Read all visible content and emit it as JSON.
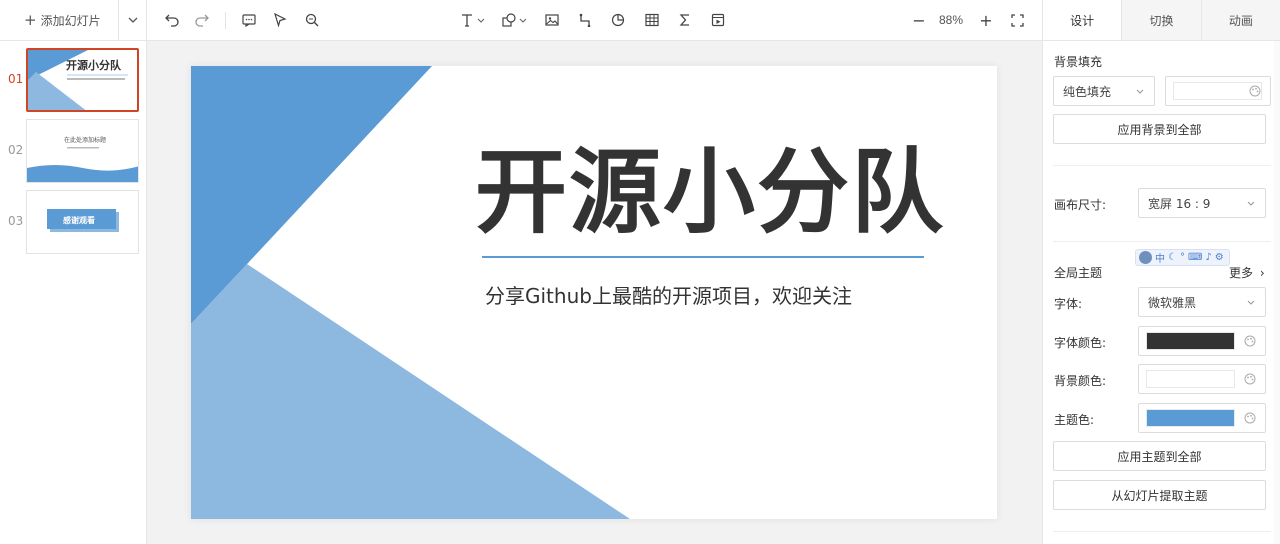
{
  "left_panel": {
    "add_button_label": "添加幻灯片",
    "thumbnails": [
      {
        "number": "01",
        "title": "开源小分队",
        "active": true
      },
      {
        "number": "02",
        "title": "在此处添加标题",
        "active": false
      },
      {
        "number": "03",
        "title": "感谢观看",
        "active": false
      }
    ]
  },
  "toolbar": {
    "icons": [
      "undo-icon",
      "redo-icon",
      "comment-icon",
      "select-cursor-icon",
      "search-icon",
      "text-icon",
      "shape-icon",
      "image-icon",
      "line-icon",
      "chart-icon",
      "table-icon",
      "formula-icon",
      "media-icon"
    ],
    "zoom_minus": "−",
    "zoom_level": "88%",
    "zoom_plus": "+"
  },
  "slide": {
    "title": "开源小分队",
    "subtitle": "分享Github上最酷的开源项目，欢迎关注",
    "colors": {
      "dark_blue": "#5b9bd5",
      "light_blue": "#8db8e0",
      "title": "#333333",
      "line": "#5a9bd5"
    }
  },
  "right_panel": {
    "tabs": [
      "设计",
      "切换",
      "动画"
    ],
    "background_fill_label": "背景填充",
    "fill_type_value": "纯色填充",
    "apply_background_label": "应用背景到全部",
    "canvas_size_label": "画布尺寸:",
    "canvas_size_value": "宽屏 16 : 9",
    "global_theme_label": "全局主题",
    "more_label": "更多",
    "font_label": "字体:",
    "font_value": "微软雅黑",
    "font_color_label": "字体颜色:",
    "font_color": "#333333",
    "bg_color_label": "背景颜色:",
    "bg_color": "#ffffff",
    "theme_color_label": "主题色:",
    "theme_color": "#5b9bd5",
    "apply_theme_label": "应用主题到全部",
    "extract_theme_label": "从幻灯片提取主题",
    "ime_toolbar_text": "中"
  }
}
